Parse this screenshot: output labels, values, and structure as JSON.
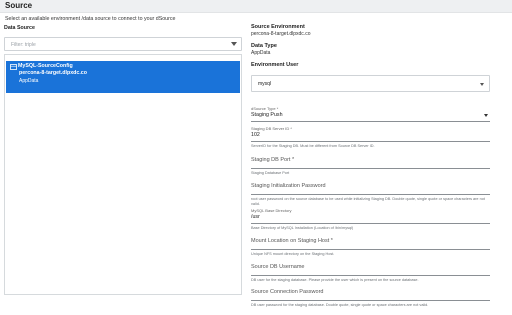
{
  "header": {
    "title": "Source"
  },
  "subtitle": "Select an available environment /data source to connect to your dSource",
  "data_source": {
    "label": "Data Source",
    "filter_placeholder": "Filter: triple",
    "items": [
      {
        "name": "MySQL-SourceConfig",
        "host": "percona-8-target.dlpxdc.co",
        "type": "AppData"
      }
    ]
  },
  "source_environment": {
    "label": "Source Environment",
    "value": "percona-8-target.dlpxdc.co"
  },
  "data_type": {
    "label": "Data Type",
    "value": "AppData"
  },
  "environment_user": {
    "label": "Environment User",
    "value": "mysql"
  },
  "fields": {
    "dsource_type": {
      "label": "dSource Type *",
      "value": "Staging Push"
    },
    "staging_db_server_id": {
      "label": "Staging DB Server ID *",
      "value": "102",
      "help": "ServerID for the Staging DB. Must be different from Source DB Server ID."
    },
    "staging_db_port": {
      "label": "Staging DB Port *",
      "help": "Staging Database Port"
    },
    "staging_init_password": {
      "label": "Staging Initialization Password",
      "help": "root user password on the source database to be used while initializing Staging DB. Double quote, single quote or space characters are not valid."
    },
    "mysql_base_directory": {
      "label": "MySQL Base Directory",
      "value": "/usr",
      "help": "Base Directory of MySQL Installation (Location of /bin/mysql)"
    },
    "mount_location": {
      "label": "Mount Location on Staging Host *",
      "help": "Unique NFS mount directory on the Staging Host."
    },
    "source_db_username": {
      "label": "Source DB Username",
      "help": "DB user for the staging database. Please provide the user which is present on the source database."
    },
    "source_connection_password": {
      "label": "Source Connection Password",
      "help": "DB user password for the staging database. Double quote, single quote or space characters are not valid."
    }
  },
  "colors": {
    "accent": "#1a73d9",
    "header_bg": "#eef0f2"
  },
  "icons": {
    "db_item": "database-icon",
    "dropdown": "chevron-down-icon"
  }
}
